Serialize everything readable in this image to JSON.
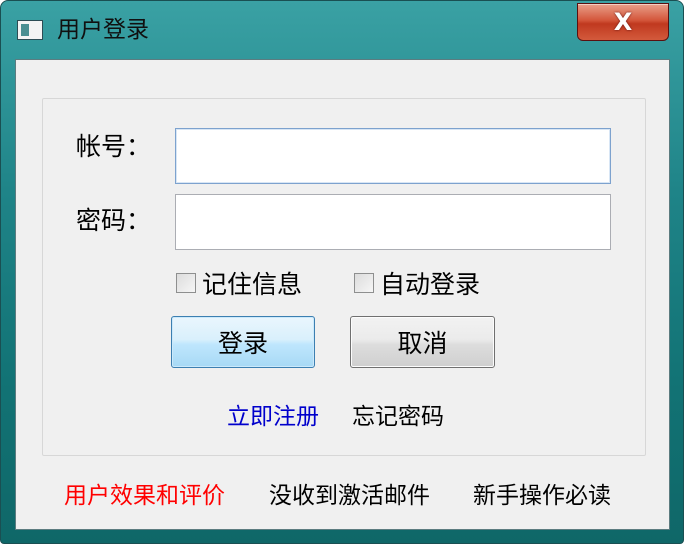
{
  "window": {
    "title": "用户登录",
    "close_glyph": "X"
  },
  "form": {
    "account_label": "帐号：",
    "account_value": "",
    "password_label": "密码：",
    "password_value": "",
    "remember_label": "记住信息",
    "remember_checked": false,
    "autologin_label": "自动登录",
    "autologin_checked": false,
    "login_button": "登录",
    "cancel_button": "取消"
  },
  "links": {
    "register": "立即注册",
    "forgot_password": "忘记密码",
    "reviews": "用户效果和评价",
    "no_activation_email": "没收到激活邮件",
    "beginner_guide": "新手操作必读"
  },
  "colors": {
    "register_link": "#0000cc",
    "reviews_link": "#ff0000",
    "default_text": "#000000"
  },
  "icons": {
    "app": "window-app-icon",
    "close": "close-icon"
  }
}
